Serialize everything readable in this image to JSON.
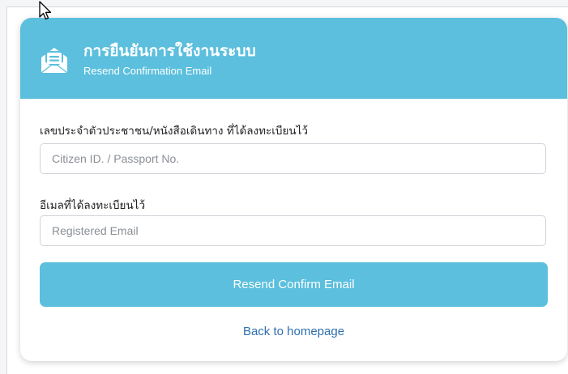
{
  "header": {
    "title": "การยืนยันการใช้งานระบบ",
    "subtitle": "Resend Confirmation Email",
    "icon": "envelope-open-icon",
    "background_color": "#5bbfdd"
  },
  "form": {
    "citizen_label": "เลขประจำตัวประชาชน/หนังสือเดินทาง ที่ได้ลงทะเบียนไว้",
    "citizen_placeholder": "Citizen ID. / Passport No.",
    "citizen_value": "",
    "email_label": "อีเมลที่ได้ลงทะเบียนไว้",
    "email_placeholder": "Registered Email",
    "email_value": "",
    "submit_label": "Resend Confirm Email",
    "back_link_label": "Back to homepage"
  },
  "colors": {
    "accent": "#5bbfdd",
    "link": "#2f6fae"
  }
}
